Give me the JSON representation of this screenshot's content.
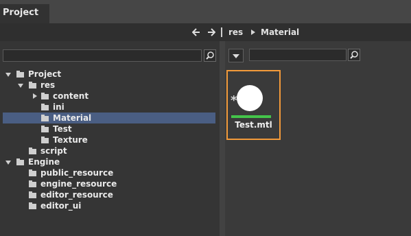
{
  "window": {
    "tab_title": "Project"
  },
  "breadcrumb": {
    "parts": [
      "res",
      "Material"
    ]
  },
  "left_search": {
    "value": "",
    "placeholder": ""
  },
  "right_search": {
    "value": "",
    "placeholder": ""
  },
  "tree": {
    "items": [
      {
        "label": "Project",
        "expanded": true
      },
      {
        "label": "res",
        "expanded": true
      },
      {
        "label": "content",
        "expanded": false
      },
      {
        "label": "ini"
      },
      {
        "label": "Material",
        "selected": true
      },
      {
        "label": "Test"
      },
      {
        "label": "Texture"
      },
      {
        "label": "script"
      },
      {
        "label": "Engine",
        "expanded": true
      },
      {
        "label": "public_resource"
      },
      {
        "label": "engine_resource"
      },
      {
        "label": "editor_resource"
      },
      {
        "label": "editor_ui"
      }
    ]
  },
  "assets": [
    {
      "name": "Test.mtl",
      "icon": "material-sphere-icon",
      "badge_icon": "asterisk-icon"
    }
  ],
  "colors": {
    "selection": "#4a5e83",
    "highlight": "#f39a3a",
    "progress": "#44c44a"
  }
}
